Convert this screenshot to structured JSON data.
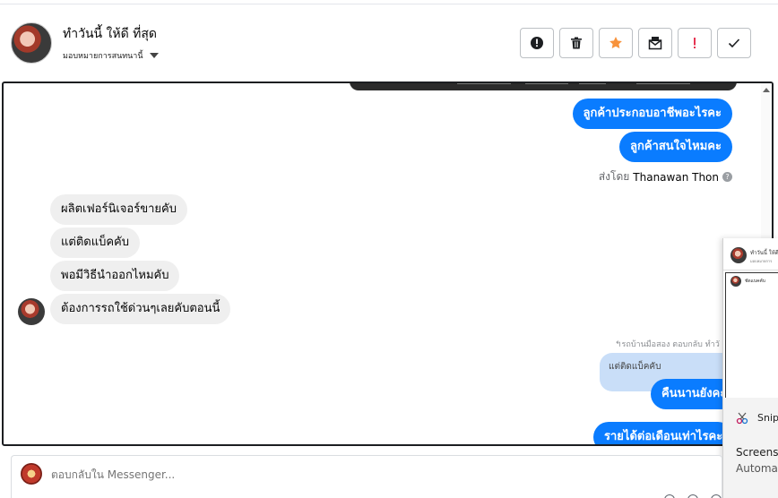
{
  "header": {
    "contact_name": "ทำวันนี้ ให้ดี ที่สุด",
    "assign_label": "มอบหมายการสนทนานี้",
    "toolbar": [
      {
        "name": "report-button",
        "icon": "exclamation-circle-icon"
      },
      {
        "name": "delete-button",
        "icon": "trash-icon"
      },
      {
        "name": "star-button",
        "icon": "star-icon",
        "color": "#f7923b"
      },
      {
        "name": "mark-unread-button",
        "icon": "envelope-icon"
      },
      {
        "name": "spam-button",
        "icon": "exclamation-icon",
        "color": "#e41e3f"
      },
      {
        "name": "done-button",
        "icon": "check-icon"
      }
    ]
  },
  "thread": {
    "outgoing_1": "ลูกค้าประกอบอาชีพอะไรคะ",
    "outgoing_2": "ลูกค้าสนใจไหมคะ",
    "sent_by_prefix": "ส่งโดย",
    "sent_by_name": "Thanawan Thon",
    "incoming": [
      "ผลิตเฟอร์นิเจอร์ขายคับ",
      "แต่ติดแบ็คคับ",
      "พอมีวิธีนำออกไหมคับ",
      "ต้องการรถใช้ด่วนๆเลยคับตอนนี้"
    ],
    "reply_note": "↰รถบ้านมือสอง ตอบกลับ ทำวั",
    "quoted": "แต่ติดแบ็คคับ",
    "outgoing_3": "คืนนานยังคะ",
    "outgoing_4": "รายได้ต่อเดือนเท่าไรคะ"
  },
  "popup": {
    "name": "ทำวันนี้ ให้ดี",
    "sub": "มอบหมายการ",
    "item": "ชัดแบคคับ",
    "snip_name": "Snip",
    "snip_line1": "Screens",
    "snip_line2": "Automa"
  },
  "composer": {
    "placeholder": "ตอบกลับใน Messenger..."
  },
  "colors": {
    "accent": "#0a7cff",
    "incoming_bubble": "#efefef",
    "quote_bubble": "#c9def8"
  }
}
